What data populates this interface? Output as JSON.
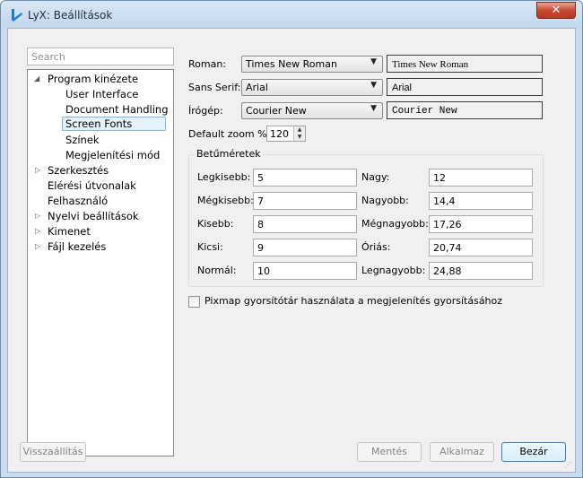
{
  "window": {
    "title": "LyX: Beállítások",
    "close_glyph": "✕"
  },
  "search": {
    "placeholder": "Search"
  },
  "tree": {
    "items": [
      {
        "label": "Program kinézete",
        "expanded": true
      },
      {
        "label": "User Interface"
      },
      {
        "label": "Document Handling"
      },
      {
        "label": "Screen Fonts",
        "selected": true
      },
      {
        "label": "Színek"
      },
      {
        "label": "Megjelenítési mód"
      },
      {
        "label": "Szerkesztés",
        "collapsed": true
      },
      {
        "label": "Elérési útvonalak"
      },
      {
        "label": "Felhasználó"
      },
      {
        "label": "Nyelvi beállítások",
        "collapsed": true
      },
      {
        "label": "Kimenet",
        "collapsed": true
      },
      {
        "label": "Fájl kezelés",
        "collapsed": true
      }
    ],
    "expanded_glyph": "◢",
    "collapsed_glyph": "▷"
  },
  "fonts": {
    "roman_label": "Roman:",
    "roman_value": "Times New Roman",
    "roman_preview": "Times New Roman",
    "sans_label": "Sans Serif:",
    "sans_value": "Arial",
    "sans_preview": "Arial",
    "typewriter_label": "Írógép:",
    "typewriter_value": "Courier New",
    "typewriter_preview": "Courier New",
    "dropdown_glyph": "▼"
  },
  "zoom": {
    "label": "Default zoom %:",
    "value": "120",
    "up_glyph": "▲",
    "down_glyph": "▼"
  },
  "sizes": {
    "title": "Betűméretek",
    "left": [
      {
        "label": "Legkisebb:",
        "value": "5"
      },
      {
        "label": "Mégkisebb:",
        "value": "7"
      },
      {
        "label": "Kisebb:",
        "value": "8"
      },
      {
        "label": "Kicsi:",
        "value": "9"
      },
      {
        "label": "Normál:",
        "value": "10"
      }
    ],
    "right": [
      {
        "label": "Nagy:",
        "value": "12"
      },
      {
        "label": "Nagyobb:",
        "value": "14,4"
      },
      {
        "label": "Mégnagyobb:",
        "value": "17,26"
      },
      {
        "label": "Óriás:",
        "value": "20,74"
      },
      {
        "label": "Legnagyobb:",
        "value": "24,88"
      }
    ]
  },
  "pixmap": {
    "label": "Pixmap gyorsítótár használata a megjelenítés gyorsításához",
    "checked": false
  },
  "buttons": {
    "restore": "Visszaállítás",
    "save": "Mentés",
    "apply": "Alkalmaz",
    "close": "Bezár"
  },
  "colors": {
    "titlebar": "#c4d7ec",
    "close": "#c94b32",
    "selection": "#e5f1fb",
    "lyx_logo": "#1c7bd6"
  }
}
